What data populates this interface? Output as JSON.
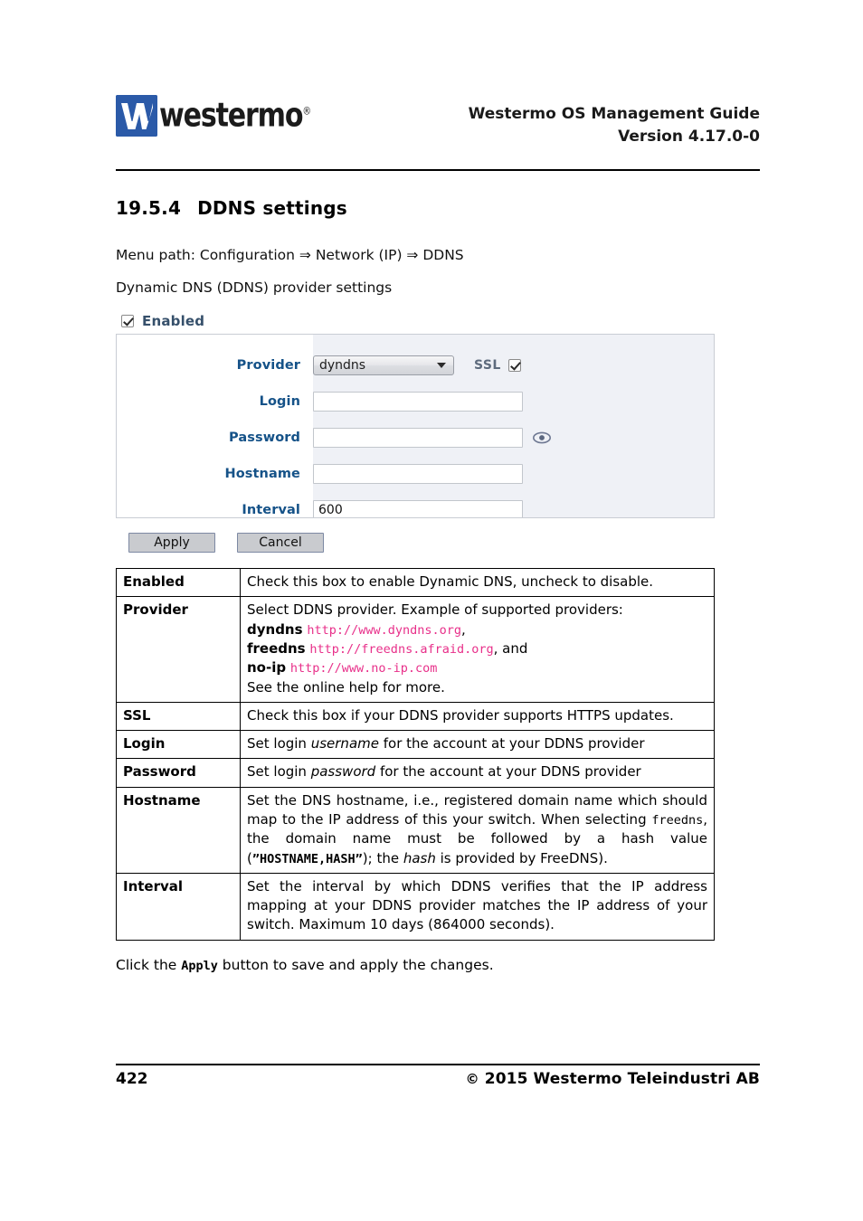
{
  "header": {
    "logo_word": "westermo",
    "logo_reg": "®",
    "title_line1": "Westermo OS Management Guide",
    "title_line2": "Version 4.17.0-0"
  },
  "section": {
    "number": "19.5.4",
    "title": "DDNS settings",
    "menu_path": "Menu path: Configuration ⇒ Network (IP) ⇒ DDNS",
    "intro": "Dynamic DNS (DDNS) provider settings"
  },
  "form": {
    "enabled_label": "Enabled",
    "enabled_checked": true,
    "fields": [
      {
        "label": "Provider",
        "type": "select",
        "value": "dyndns"
      },
      {
        "label": "Login",
        "type": "text",
        "value": ""
      },
      {
        "label": "Password",
        "type": "text",
        "value": ""
      },
      {
        "label": "Hostname",
        "type": "text",
        "value": ""
      },
      {
        "label": "Interval",
        "type": "text",
        "value": "600"
      }
    ],
    "ssl_label": "SSL",
    "ssl_checked": true,
    "apply_label": "Apply",
    "cancel_label": "Cancel"
  },
  "table": {
    "rows": [
      {
        "term": "Enabled",
        "text": "Check this box to enable Dynamic DNS, uncheck to disable."
      },
      {
        "term": "Provider",
        "lead": "Select DDNS provider. Example of supported providers:",
        "providers": [
          {
            "name": "dyndns",
            "url": "http://www.dyndns.org",
            "tail": ","
          },
          {
            "name": "freedns",
            "url": "http://freedns.afraid.org",
            "tail": ", and"
          },
          {
            "name": "no-ip",
            "url": "http://www.no-ip.com",
            "tail": ""
          }
        ],
        "tail_line": "See the online help for more."
      },
      {
        "term": "SSL",
        "text": "Check this box if your DDNS provider supports HTTPS updates."
      },
      {
        "term": "Login",
        "text_a": "Set login ",
        "text_em": "username",
        "text_b": " for the account at your DDNS provider"
      },
      {
        "term": "Password",
        "text_a": "Set login ",
        "text_em": "password",
        "text_b": " for the account at your DDNS provider"
      },
      {
        "term": "Hostname",
        "p1": "Set the DNS hostname, i.e., registered domain name which should map to the IP address of this your switch. When selecting ",
        "mono1": "freedns",
        "p2": ", the domain name must be followed by a hash value (",
        "mono2": "”HOSTNAME,HASH”",
        "p3": "); the ",
        "em1": "hash",
        "p4": " is provided by FreeDNS)."
      },
      {
        "term": "Interval",
        "text": "Set the interval by which DDNS verifies that the IP address mapping at your DDNS provider matches the IP address of your switch. Maximum 10 days (864000 seconds)."
      }
    ]
  },
  "closing": {
    "pre": "Click the ",
    "mono": "Apply",
    "post": " button to save and apply the changes."
  },
  "footer": {
    "page_number": "422",
    "copyright_glyph": "©",
    "copyright_text": "2015 Westermo Teleindustri AB"
  }
}
